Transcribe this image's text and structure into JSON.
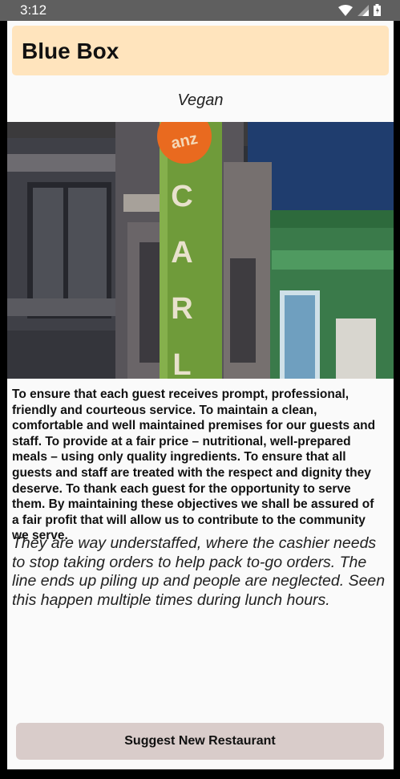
{
  "status": {
    "time": "3:12"
  },
  "restaurant": {
    "name": "Blue Box",
    "category": "Vegan",
    "photo_sign_letters": [
      "C",
      "A",
      "R",
      "L"
    ],
    "photo_badge": "anz",
    "mission": "To ensure that each guest receives prompt, professional, friendly and courteous service. To maintain a clean, comfortable and well maintained premises for our guests and staff. To provide at a fair price – nutritional, well-prepared meals – using only quality ingredients. To ensure that all guests and staff are treated with the respect and dignity they deserve. To thank each guest for the opportunity to serve them. By maintaining these objectives we shall be assured of a fair profit that will allow us to contribute to the community we serve.",
    "review": "They are way understaffed, where the cashier needs to stop taking orders to help pack to-go orders. The line ends up piling up and people are neglected.  Seen this happen multiple times during lunch hours."
  },
  "actions": {
    "suggest_label": "Suggest New Restaurant"
  },
  "colors": {
    "title_card": "#ffe4bd",
    "button": "#d9ccca",
    "status_bar": "#5f5f5f"
  },
  "icons": [
    "wifi-icon",
    "signal-icon",
    "battery-icon"
  ]
}
